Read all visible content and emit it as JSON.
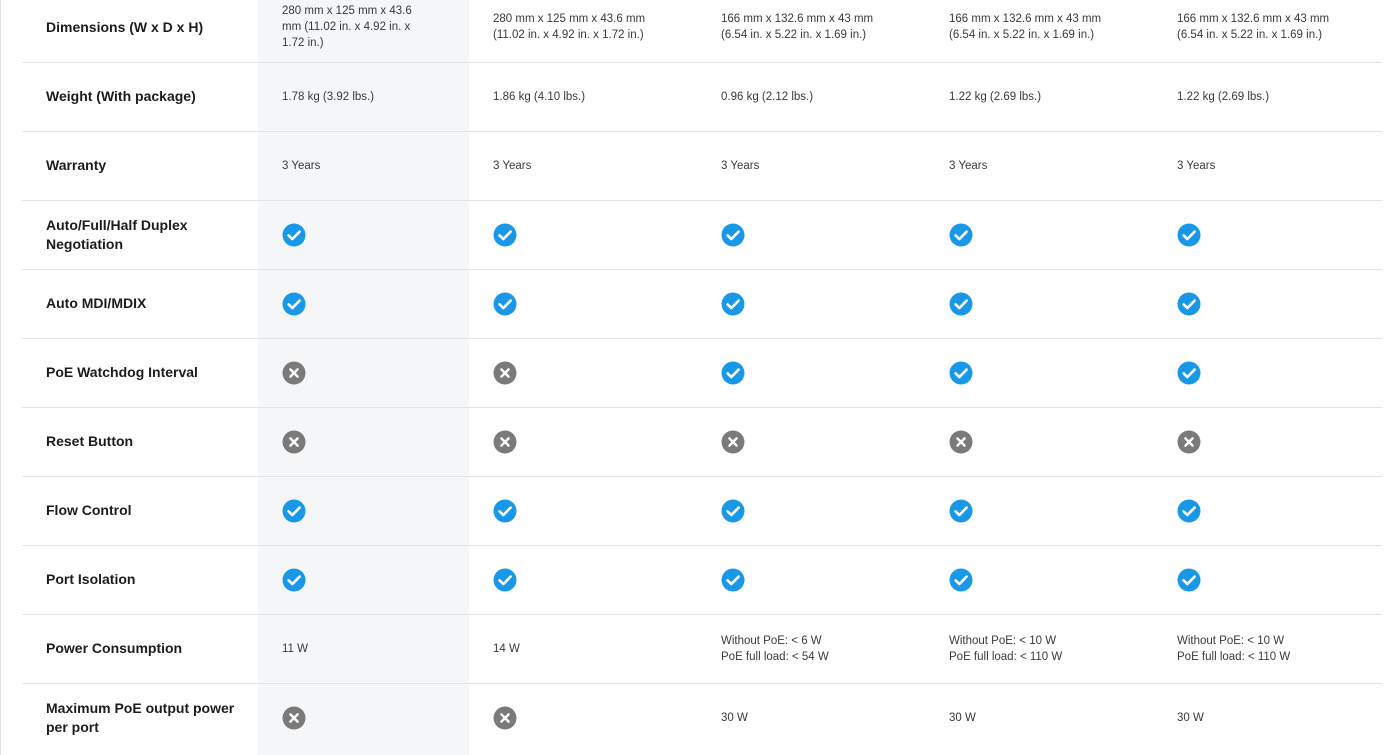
{
  "colors": {
    "check": "#1a98e8",
    "cross": "#7a7a7a",
    "highlight_column": "#f4f6f8",
    "divider": "#e4e4e4"
  },
  "rows": [
    {
      "label": "Dimensions (W x D x H)",
      "cells": [
        {
          "type": "text",
          "lines": [
            "280 mm x 125 mm x 43.6",
            "mm (11.02 in. x 4.92 in. x",
            "1.72 in.)"
          ]
        },
        {
          "type": "text",
          "lines": [
            "280 mm x 125 mm x 43.6 mm",
            "(11.02 in. x 4.92 in. x 1.72 in.)"
          ]
        },
        {
          "type": "text",
          "lines": [
            "166 mm x 132.6 mm x 43 mm",
            "(6.54 in. x 5.22 in. x 1.69 in.)"
          ]
        },
        {
          "type": "text",
          "lines": [
            "166 mm x 132.6 mm x 43 mm",
            "(6.54 in. x 5.22 in. x 1.69 in.)"
          ]
        },
        {
          "type": "text",
          "lines": [
            "166 mm x 132.6 mm x 43 mm",
            "(6.54 in. x 5.22 in. x 1.69 in.)"
          ]
        }
      ]
    },
    {
      "label": "Weight (With package)",
      "cells": [
        {
          "type": "text",
          "lines": [
            "1.78 kg (3.92 lbs.)"
          ]
        },
        {
          "type": "text",
          "lines": [
            "1.86 kg (4.10 lbs.)"
          ]
        },
        {
          "type": "text",
          "lines": [
            "0.96 kg (2.12 lbs.)"
          ]
        },
        {
          "type": "text",
          "lines": [
            "1.22 kg (2.69 lbs.)"
          ]
        },
        {
          "type": "text",
          "lines": [
            "1.22 kg (2.69 lbs.)"
          ]
        }
      ]
    },
    {
      "label": "Warranty",
      "cells": [
        {
          "type": "text",
          "lines": [
            "3 Years"
          ]
        },
        {
          "type": "text",
          "lines": [
            "3 Years"
          ]
        },
        {
          "type": "text",
          "lines": [
            "3 Years"
          ]
        },
        {
          "type": "text",
          "lines": [
            "3 Years"
          ]
        },
        {
          "type": "text",
          "lines": [
            "3 Years"
          ]
        }
      ]
    },
    {
      "label": "Auto/Full/Half Duplex Negotiation",
      "cells": [
        {
          "type": "check"
        },
        {
          "type": "check"
        },
        {
          "type": "check"
        },
        {
          "type": "check"
        },
        {
          "type": "check"
        }
      ]
    },
    {
      "label": "Auto MDI/MDIX",
      "cells": [
        {
          "type": "check"
        },
        {
          "type": "check"
        },
        {
          "type": "check"
        },
        {
          "type": "check"
        },
        {
          "type": "check"
        }
      ]
    },
    {
      "label": "PoE Watchdog Interval",
      "cells": [
        {
          "type": "cross"
        },
        {
          "type": "cross"
        },
        {
          "type": "check"
        },
        {
          "type": "check"
        },
        {
          "type": "check"
        }
      ]
    },
    {
      "label": "Reset Button",
      "cells": [
        {
          "type": "cross"
        },
        {
          "type": "cross"
        },
        {
          "type": "cross"
        },
        {
          "type": "cross"
        },
        {
          "type": "cross"
        }
      ]
    },
    {
      "label": "Flow Control",
      "cells": [
        {
          "type": "check"
        },
        {
          "type": "check"
        },
        {
          "type": "check"
        },
        {
          "type": "check"
        },
        {
          "type": "check"
        }
      ]
    },
    {
      "label": "Port Isolation",
      "cells": [
        {
          "type": "check"
        },
        {
          "type": "check"
        },
        {
          "type": "check"
        },
        {
          "type": "check"
        },
        {
          "type": "check"
        }
      ]
    },
    {
      "label": "Power Consumption",
      "cells": [
        {
          "type": "text",
          "lines": [
            "11 W"
          ]
        },
        {
          "type": "text",
          "lines": [
            "14 W"
          ]
        },
        {
          "type": "text",
          "lines": [
            "Without PoE: < 6 W",
            "PoE full load: < 54 W"
          ]
        },
        {
          "type": "text",
          "lines": [
            "Without PoE: < 10 W",
            "PoE full load: < 110 W"
          ]
        },
        {
          "type": "text",
          "lines": [
            "Without PoE: < 10 W",
            "PoE full load: < 110 W"
          ]
        }
      ]
    },
    {
      "label": "Maximum PoE output power per port",
      "cells": [
        {
          "type": "cross"
        },
        {
          "type": "cross"
        },
        {
          "type": "text",
          "lines": [
            "30 W"
          ]
        },
        {
          "type": "text",
          "lines": [
            "30 W"
          ]
        },
        {
          "type": "text",
          "lines": [
            "30 W"
          ]
        }
      ]
    }
  ]
}
